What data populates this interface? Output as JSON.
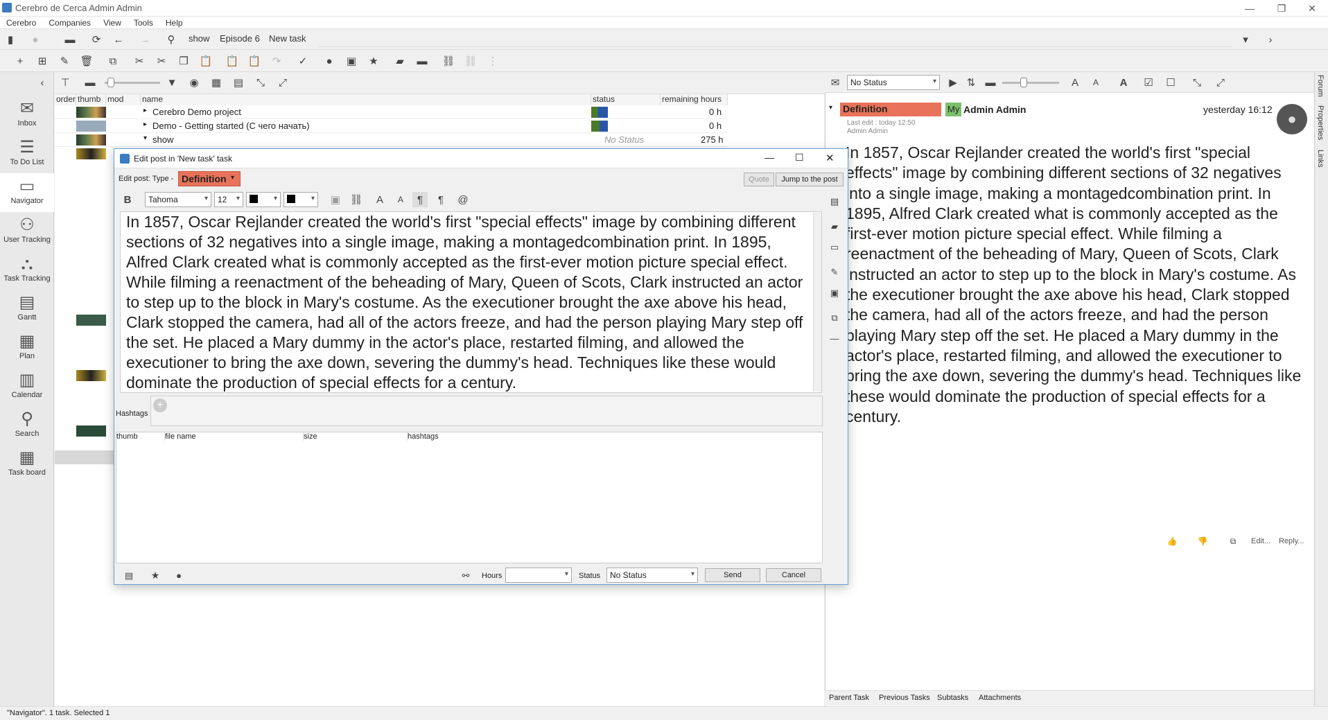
{
  "window": {
    "title": "Cerebro de Cerca  Admin Admin"
  },
  "menu": [
    "Cerebro",
    "Companies",
    "View",
    "Tools",
    "Help"
  ],
  "breadcrumb": [
    "show",
    "Episode 6",
    "New task"
  ],
  "leftnav": [
    {
      "label": "Inbox",
      "icon": "inbox-icon",
      "glyph": "✉"
    },
    {
      "label": "To Do List",
      "icon": "todo-list-icon",
      "glyph": "☰"
    },
    {
      "label": "Navigator",
      "icon": "folder-icon",
      "glyph": "▭"
    },
    {
      "label": "User Tracking",
      "icon": "user-tracking-icon",
      "glyph": "⚇"
    },
    {
      "label": "Task Tracking",
      "icon": "task-tracking-icon",
      "glyph": "⛬"
    },
    {
      "label": "Gantt",
      "icon": "gantt-icon",
      "glyph": "▤"
    },
    {
      "label": "Plan",
      "icon": "plan-icon",
      "glyph": "▦"
    },
    {
      "label": "Calendar",
      "icon": "calendar-icon",
      "glyph": "▥"
    },
    {
      "label": "Search",
      "icon": "search-icon",
      "glyph": "⚲"
    },
    {
      "label": "Task board",
      "icon": "task-board-icon",
      "glyph": "▦"
    }
  ],
  "grid": {
    "columns": [
      "order",
      "thumb",
      "mod",
      "name",
      "status",
      "remaining hours"
    ],
    "rows": [
      {
        "name": "Cerebro Demo project",
        "status": "",
        "hours": "0 h"
      },
      {
        "name": "Demo - Getting started (С чего начать)",
        "status": "",
        "hours": "0 h"
      },
      {
        "name": "show",
        "status": "No Status",
        "hours": "275 h"
      }
    ]
  },
  "dialog": {
    "title": "Edit post in 'New task' task",
    "type_label": "Edit post: Type -",
    "type_value": "Definition",
    "quote_btn": "Quote",
    "jump_btn": "Jump to the post",
    "font": "Tahoma",
    "size": "12",
    "body": "In 1857, Oscar Rejlander created the world's first \"special effects\" image by combining different sections of 32 negatives into a single image, making a montagedcombination print. In 1895, Alfred Clark created what is commonly accepted as the first-ever motion picture special effect. While filming a reenactment of the beheading of Mary, Queen of Scots, Clark instructed an actor to step up to the block in Mary's costume. As the executioner brought the axe above his head, Clark stopped the camera, had all of the actors freeze, and had the person playing Mary step off the set. He placed a Mary dummy in the actor's place, restarted filming, and allowed the executioner to bring the axe down, severing the dummy's head. Techniques like these would dominate the production of special effects for a century.",
    "hashtags_label": "Hashtags",
    "attach_cols": [
      "thumb",
      "file name",
      "size",
      "hashtags"
    ],
    "hours_label": "Hours",
    "status_label": "Status",
    "status_value": "No Status",
    "send": "Send",
    "cancel": "Cancel"
  },
  "right": {
    "status_select": "No Status",
    "post_type": "Definition",
    "my_badge": "My",
    "author": "Admin Admin",
    "time": "yesterday 16:12",
    "last_edit": "Last edit : today 12:50",
    "last_edit_by": "Admin Admin",
    "edit": "Edit...",
    "reply": "Reply...",
    "bottom_tabs": [
      "Parent Task",
      "Previous Tasks",
      "Subtasks",
      "Attachments"
    ],
    "side_tabs": [
      "Forum",
      "Properties",
      "Links"
    ]
  },
  "statusbar": "\"Navigator\". 1 task. Selected 1",
  "colors": {
    "definition": "#e8735a",
    "my": "#7cc06c",
    "accent": "#2b78c8"
  }
}
